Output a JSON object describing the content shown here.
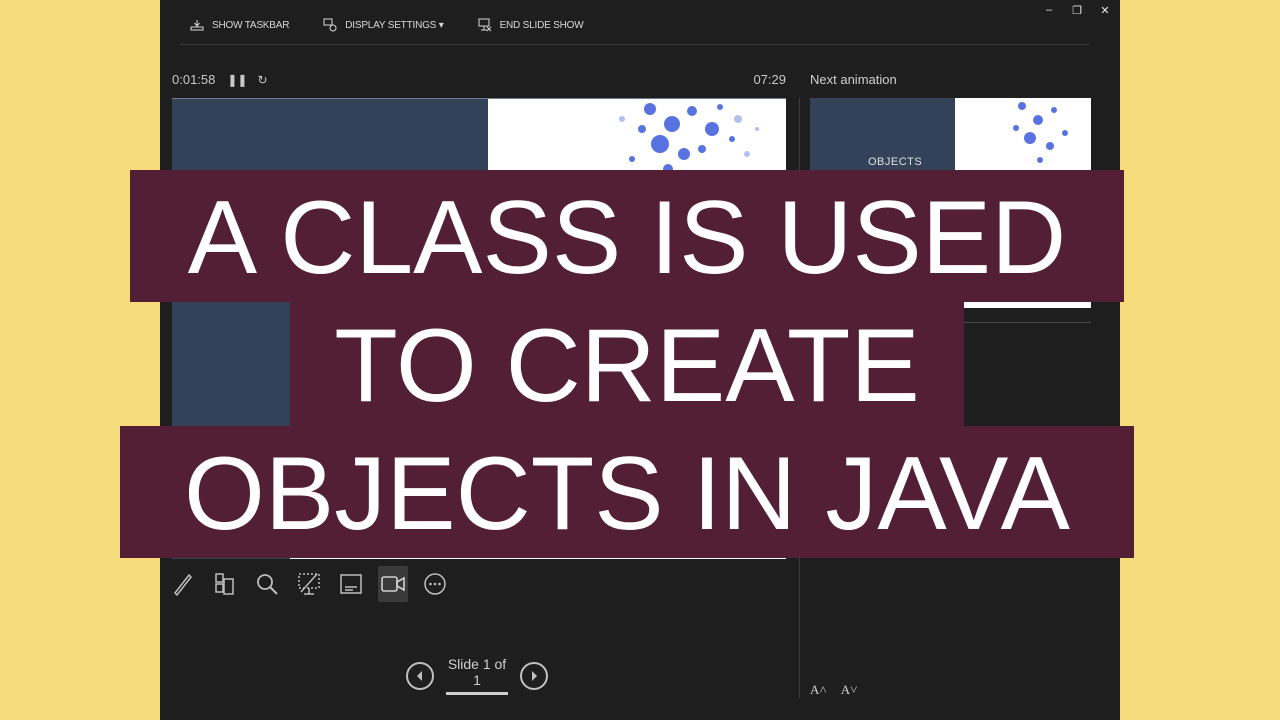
{
  "toolbar": {
    "show_taskbar": "SHOW TASKBAR",
    "display_settings": "DISPLAY SETTINGS ▾",
    "end_slide_show": "END SLIDE SHOW"
  },
  "window_controls": {
    "minimize": "–",
    "restore": "❐",
    "close": "✕"
  },
  "timer": {
    "elapsed": "0:01:58",
    "pause_icon": "pause-icon",
    "restart_icon": "restart-icon",
    "total": "07:29"
  },
  "next_animation": {
    "label": "Next animation",
    "thumb_text": "OBJECTS"
  },
  "tools": [
    "pen-icon",
    "slides-icon",
    "zoom-icon",
    "black-screen-icon",
    "subtitles-icon",
    "camera-icon",
    "more-options-icon"
  ],
  "navigation": {
    "slide_counter": "Slide 1 of 1"
  },
  "font_size": {
    "increase": "A˄",
    "decrease": "A˅"
  },
  "overlay": {
    "line1": "A CLASS IS USED",
    "line2": "TO CREATE",
    "line3": "OBJECTS IN JAVA",
    "background_color": "#521f34"
  },
  "colors": {
    "page_background": "#f5db7c",
    "window_background": "#1e1e1e",
    "slide_navy": "#334259",
    "dot_blue": "#3b5bdb"
  }
}
